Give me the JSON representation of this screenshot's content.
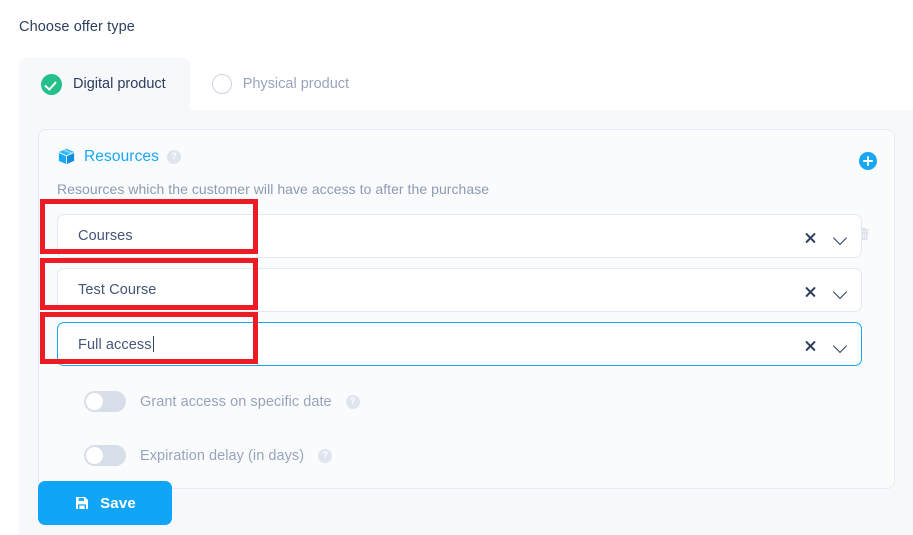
{
  "header": {
    "title": "Choose offer type"
  },
  "tabs": [
    {
      "label": "Digital product",
      "icon": "check-circle-icon",
      "selected": true
    },
    {
      "label": "Physical product",
      "icon": "radio-empty-icon",
      "selected": false
    }
  ],
  "resources": {
    "icon": "package-box-icon",
    "title": "Resources",
    "help_icon": "?",
    "description": "Resources which the customer will have access to after the purchase",
    "add_icon": "plus-circle-icon",
    "delete_icon": "trash-icon",
    "rows": [
      {
        "value": "Courses",
        "clear_icon": "close-icon",
        "chevron_icon": "chevron-down-icon",
        "focused": false
      },
      {
        "value": "Test Course",
        "clear_icon": "close-icon",
        "chevron_icon": "chevron-down-icon",
        "focused": false
      },
      {
        "value": "Full access",
        "clear_icon": "close-icon",
        "chevron_icon": "chevron-down-icon",
        "focused": true
      }
    ],
    "toggles": [
      {
        "label": "Grant access on specific date",
        "help_icon": "?",
        "on": false
      },
      {
        "label": "Expiration delay (in days)",
        "help_icon": "?",
        "on": false
      }
    ]
  },
  "actions": {
    "save_label": "Save",
    "save_icon": "floppy-save-icon"
  },
  "colors": {
    "accent_blue": "#17a7f5",
    "save_blue": "#11a5f7",
    "green_check": "#24c08a",
    "text_dark": "#2d3e5e",
    "text_muted": "#8e99b3",
    "highlight_red": "#ed1c24",
    "panel_bg": "#f7f8fb"
  }
}
